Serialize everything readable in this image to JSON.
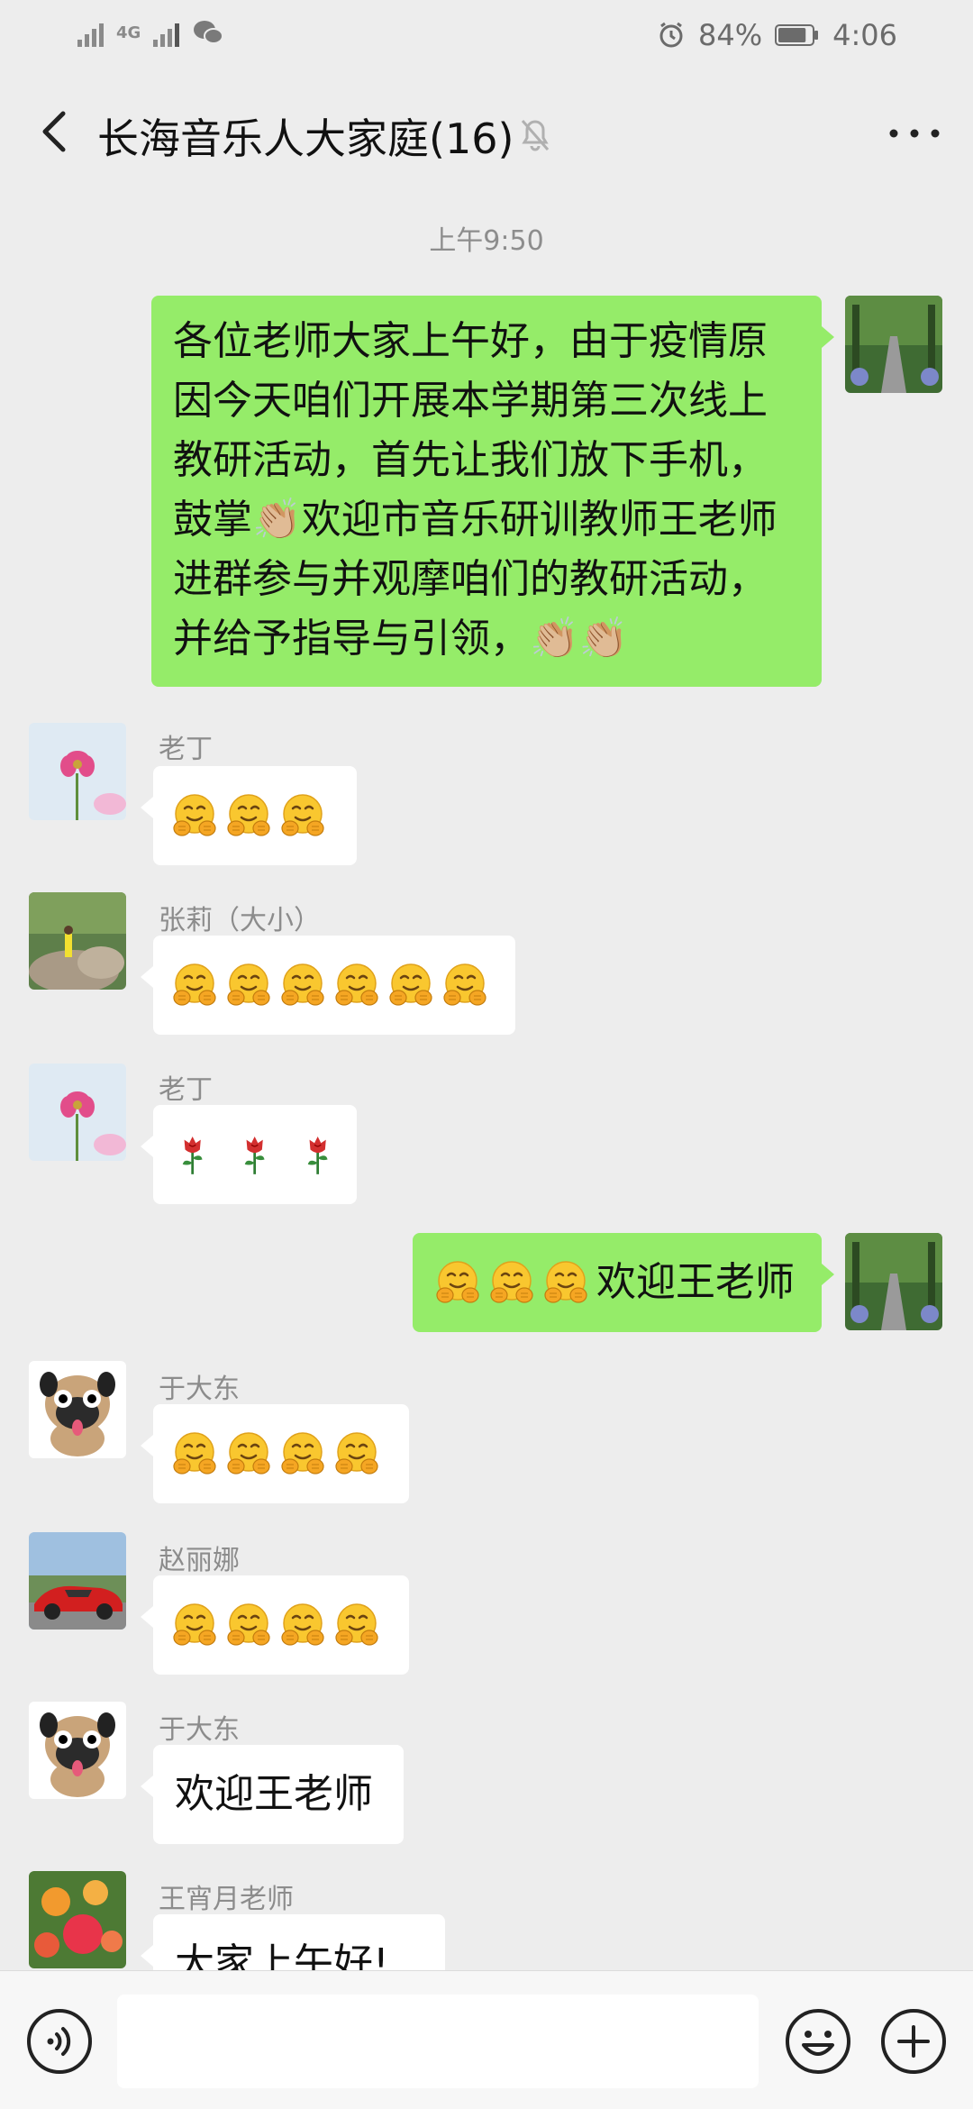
{
  "status_bar": {
    "network_label": "4G",
    "alarm_icon": "alarm-icon",
    "battery_percent": "84%",
    "battery_level": 0.84,
    "time": "4:06"
  },
  "header": {
    "title": "长海音乐人大家庭(16)",
    "back_icon": "chevron-left-icon",
    "mute_icon": "bell-off-icon",
    "more_icon": "more-dots-icon"
  },
  "timestamp": "上午9:50",
  "messages": [
    {
      "direction": "out",
      "text": "各位老师大家上午好，由于疫情原因今天咱们开展本学期第三次线上教研活动，首先让我们放下手机，鼓掌👏🏼欢迎市音乐研训教师王老师进群参与并观摩咱们的教研活动，并给予指导与引领，👏🏼👏🏼"
    },
    {
      "direction": "in",
      "sender": "老丁",
      "emoji": "hugging-face",
      "count": 3
    },
    {
      "direction": "in",
      "sender": "张莉（大小）",
      "emoji": "hugging-face",
      "count": 6
    },
    {
      "direction": "in",
      "sender": "老丁",
      "emoji": "rose",
      "count": 3
    },
    {
      "direction": "out",
      "prefix_emoji": "hugging-face",
      "prefix_count": 3,
      "text": "欢迎王老师"
    },
    {
      "direction": "in",
      "sender": "于大东",
      "emoji": "hugging-face",
      "count": 4
    },
    {
      "direction": "in",
      "sender": "赵丽娜",
      "emoji": "hugging-face",
      "count": 4
    },
    {
      "direction": "in",
      "sender": "于大东",
      "text": "欢迎王老师"
    },
    {
      "direction": "in",
      "sender": "王宵月老师",
      "text": "大家上午好!"
    }
  ],
  "input_bar": {
    "voice_icon": "voice-icon",
    "input_value": "",
    "emoji_icon": "emoji-icon",
    "plus_icon": "plus-icon"
  },
  "colors": {
    "background": "#ededed",
    "outgoing_bubble": "#95ec69",
    "incoming_bubble": "#ffffff"
  }
}
